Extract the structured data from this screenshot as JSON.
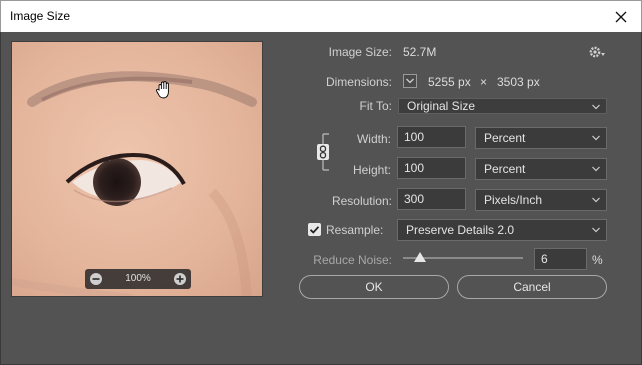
{
  "window": {
    "title": "Image Size"
  },
  "preview": {
    "zoom": "100%"
  },
  "image_size": {
    "label": "Image Size:",
    "value": "52.7M"
  },
  "dimensions": {
    "label": "Dimensions:",
    "width": "5255 px",
    "times": "×",
    "height": "3503 px"
  },
  "fit_to": {
    "label": "Fit To:",
    "value": "Original Size"
  },
  "width": {
    "label": "Width:",
    "value": "100",
    "unit": "Percent"
  },
  "height": {
    "label": "Height:",
    "value": "100",
    "unit": "Percent"
  },
  "resolution": {
    "label": "Resolution:",
    "value": "300",
    "unit": "Pixels/Inch"
  },
  "resample": {
    "label": "Resample:",
    "checked": true,
    "method": "Preserve Details 2.0"
  },
  "reduce_noise": {
    "label": "Reduce Noise:",
    "value": "6",
    "unit": "%",
    "max": 100
  },
  "buttons": {
    "ok": "OK",
    "cancel": "Cancel"
  }
}
